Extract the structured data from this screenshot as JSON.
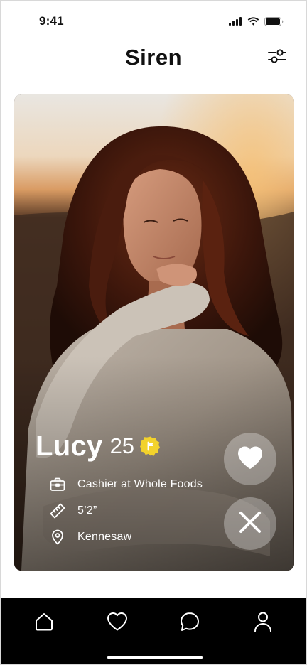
{
  "status_bar": {
    "time": "9:41"
  },
  "header": {
    "title": "Siren"
  },
  "profile": {
    "name": "Lucy",
    "age": "25",
    "verified": true,
    "job": "Cashier at Whole Foods",
    "height": "5’2”",
    "location": "Kennesaw"
  },
  "nav": {
    "items": [
      {
        "icon": "home-icon"
      },
      {
        "icon": "heart-icon"
      },
      {
        "icon": "chat-icon"
      },
      {
        "icon": "profile-icon"
      }
    ]
  },
  "colors": {
    "badge": "#F2D22C",
    "nav_background": "#000000",
    "action_button": "rgba(255,255,255,0.30)"
  }
}
